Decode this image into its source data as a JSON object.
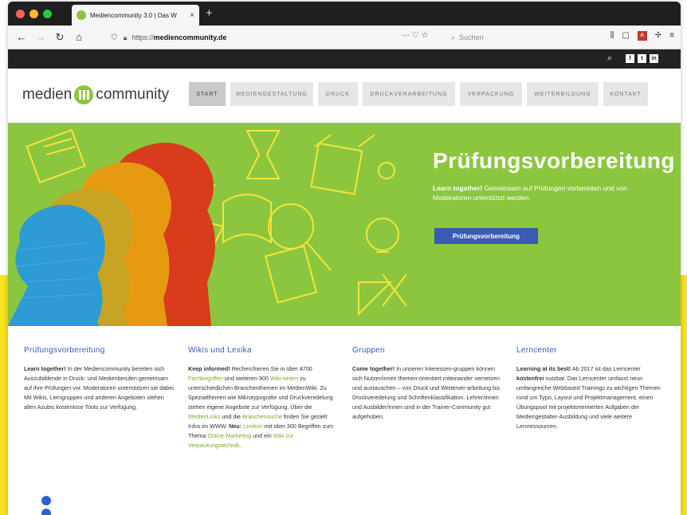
{
  "browser": {
    "tab_title": "Mediencommunity 3.0 | Das W",
    "tab_close": "×",
    "new_tab": "+",
    "url_prefix": "https://",
    "url_domain": "mediencommunity.de",
    "search_placeholder": "Suchen",
    "page_actions": "··· ♡ ☆"
  },
  "site": {
    "logo_left": "medien",
    "logo_right": "community",
    "social": [
      "f",
      "t",
      "in"
    ],
    "nav": [
      {
        "label": "Start",
        "active": true
      },
      {
        "label": "Mediengestaltung",
        "active": false
      },
      {
        "label": "Druck",
        "active": false
      },
      {
        "label": "Druckverarbeitung",
        "active": false
      },
      {
        "label": "Verpackung",
        "active": false
      },
      {
        "label": "Weiterbildung",
        "active": false
      },
      {
        "label": "Kontakt",
        "active": false
      }
    ]
  },
  "hero": {
    "title": "Prüfungsvorbereitung",
    "text_lead": "Learn together!",
    "text_rest": " Gemeinsam auf Prüfungen vorbereiten und von Moderatoren unterstützt werden.",
    "button": "Prüfungsvorbereitung"
  },
  "columns": [
    {
      "title": "Prüfungsvorbereitung",
      "lead": "Learn together!",
      "text": " In der Mediencommunity bereiten sich Auszubildende in Druck- und Medienberufen gemeinsam auf ihre Prüfungen vor. Moderatoren unterstützen sie dabei. Mit Wikis, Lerngruppen und anderen Angeboten stehen allen Azubis kostenlose Tools zur Verfügung."
    },
    {
      "title": "Wikis und Lexika",
      "lead": "Keep informed!",
      "t1": " Recherchieren Sie in über 4700 ",
      "l1": "Fachbegriffen",
      "t2": " und weiteren 900 ",
      "l2": "Wiki-seiten",
      "t3": " zu unterschiedlichen Branchenthemen im MedienWiki. Zu Spezialthemen wie Mikrotypografie und Druckveredelung stehen eigene Angebote zur Verfügung. Über die ",
      "l3": "MedienLinks",
      "t4": " und die ",
      "l4": "Branchensuche",
      "t5": " finden Sie gezielt Infos im WWW. ",
      "b1": "Neu:",
      "t6": " ",
      "l5": "Lexikon",
      "t7": " mit über 300 Begriffen zum Thema ",
      "l6": "Online-Marketing",
      "t8": " und ein ",
      "l7": "Wiki zur Verpackungstechnik",
      "t9": "."
    },
    {
      "title": "Gruppen",
      "lead": "Come together!",
      "text": " In unseren Interessen-gruppen können sich Nutzer/innen themen-orientiert miteinander vernetzen und austauschen – von Druck und Weiterver-arbeitung bis Druckveredelung und Schriftenklassifikation. Lehrer/innen und Ausbilder/innen sind in der Trainer-Community gut aufgehoben."
    },
    {
      "title": "Lerncenter",
      "lead": "Learning at its best!",
      "t1": " Ab 2017 ist das Lerncenter ",
      "b1": "kostenfrei",
      "t2": " nutzbar. Das Lerncenter umfasst neun umfangreiche Webbased Trainings zu wichtigen Themen rund um Typo, Layout und Projektmanagement, einen Übungspool mit projektorientierten Aufgaben der Mediengestalter-Ausbildung und viele weitere Lernressourcen."
    }
  ],
  "colors": {
    "brand_green": "#8cc63f",
    "link_blue": "#3b5cb5",
    "backdrop_yellow": "#f7e21b"
  }
}
